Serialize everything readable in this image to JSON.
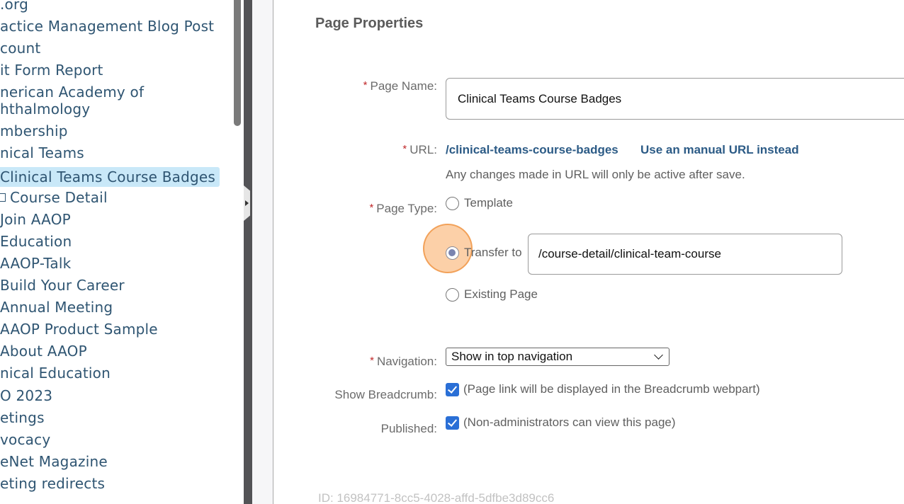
{
  "sidebar": {
    "items": [
      {
        "label": ".org",
        "selected": false
      },
      {
        "label": "actice Management Blog Post",
        "selected": false
      },
      {
        "label": "count",
        "selected": false
      },
      {
        "label": "it Form Report",
        "selected": false
      },
      {
        "label": "nerican Academy of",
        "selected": false
      },
      {
        "label": "hthalmology",
        "selected": false
      },
      {
        "label": "mbership",
        "selected": false
      },
      {
        "label": "nical Teams",
        "selected": false
      },
      {
        "label": "Clinical Teams Course Badges",
        "selected": true
      },
      {
        "label": "Course Detail",
        "selected": false,
        "icon": "page-icon"
      },
      {
        "label": "Join AAOP",
        "selected": false
      },
      {
        "label": "Education",
        "selected": false
      },
      {
        "label": "AAOP-Talk",
        "selected": false
      },
      {
        "label": "Build Your Career",
        "selected": false
      },
      {
        "label": "Annual Meeting",
        "selected": false
      },
      {
        "label": "AAOP Product Sample",
        "selected": false
      },
      {
        "label": "About AAOP",
        "selected": false
      },
      {
        "label": "nical Education",
        "selected": false
      },
      {
        "label": "O 2023",
        "selected": false
      },
      {
        "label": "etings",
        "selected": false
      },
      {
        "label": "vocacy",
        "selected": false
      },
      {
        "label": "eNet Magazine",
        "selected": false
      },
      {
        "label": "eting redirects",
        "selected": false
      }
    ]
  },
  "form": {
    "section_title": "Page Properties",
    "required_marker": "*",
    "page_name": {
      "label": "Page Name:",
      "value": "Clinical Teams Course Badges"
    },
    "url": {
      "label": "URL:",
      "value": "/clinical-teams-course-badges",
      "manual_link": "Use an manual URL instead",
      "hint": "Any changes made in URL will only be active after save."
    },
    "page_type": {
      "label": "Page Type:",
      "options": [
        {
          "label": "Template",
          "checked": false
        },
        {
          "label": "Transfer to",
          "checked": true
        },
        {
          "label": "Existing Page",
          "checked": false
        }
      ],
      "transfer_value": "/course-detail/clinical-team-course"
    },
    "navigation": {
      "label": "Navigation:",
      "selected": "Show in top navigation"
    },
    "show_breadcrumb": {
      "label": "Show Breadcrumb:",
      "checked": true,
      "description": "(Page link will be displayed in the Breadcrumb webpart)"
    },
    "published": {
      "label": "Published:",
      "checked": true,
      "description": "(Non-administrators can view this page)"
    },
    "id_text": "ID: 16984771-8cc5-4028-affd-5dfbe3d89cc6"
  },
  "colors": {
    "accent_link": "#2c5b86",
    "required": "#c0292b",
    "selected_tree_bg": "#c9e8f8",
    "checkbox": "#2a6fd6",
    "click_highlight": "#fab06e"
  }
}
